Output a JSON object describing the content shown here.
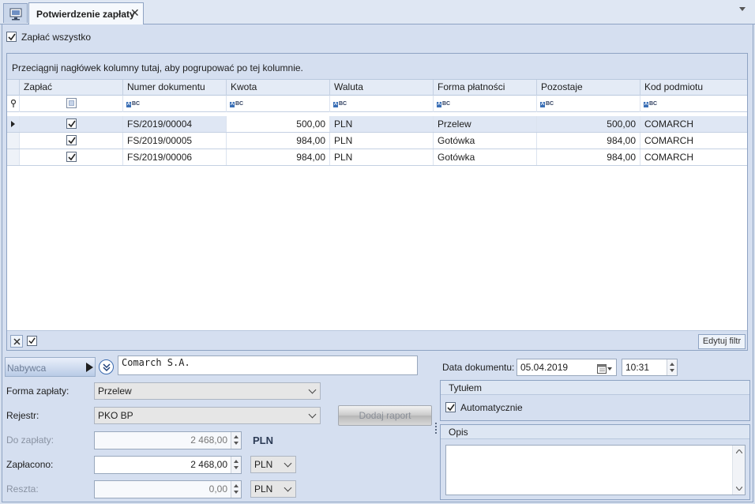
{
  "tab": {
    "title": "Potwierdzenie zapłaty",
    "close_glyph": "✕",
    "icon": "monitor-icon"
  },
  "pay_all": {
    "label": "Zapłać wszystko",
    "checked": true
  },
  "grid": {
    "group_hint": "Przeciągnij nagłówek kolumny tutaj, aby pogrupować po tej kolumnie.",
    "columns": [
      "Zapłać",
      "Numer dokumentu",
      "Kwota",
      "Waluta",
      "Forma płatności",
      "Pozostaje",
      "Kod podmiotu"
    ],
    "rows": [
      {
        "pay": true,
        "doc": "FS/2019/00004",
        "amount": "500,00",
        "currency": "PLN",
        "method": "Przelew",
        "remaining": "500,00",
        "code": "COMARCH",
        "current": true
      },
      {
        "pay": true,
        "doc": "FS/2019/00005",
        "amount": "984,00",
        "currency": "PLN",
        "method": "Gotówka",
        "remaining": "984,00",
        "code": "COMARCH",
        "current": false
      },
      {
        "pay": true,
        "doc": "FS/2019/00006",
        "amount": "984,00",
        "currency": "PLN",
        "method": "Gotówka",
        "remaining": "984,00",
        "code": "COMARCH",
        "current": false
      }
    ],
    "edit_filter": "Edytuj filtr"
  },
  "buyer": {
    "button": "Nabywca",
    "value": "Comarch S.A."
  },
  "payment_form": {
    "label": "Forma zapłaty:",
    "value": "Przelew"
  },
  "register": {
    "label": "Rejestr:",
    "value": "PKO BP"
  },
  "add_report": "Dodaj raport",
  "to_pay": {
    "label": "Do zapłaty:",
    "value": "2 468,00",
    "currency": "PLN"
  },
  "paid": {
    "label": "Zapłacono:",
    "value": "2 468,00",
    "currency": "PLN"
  },
  "change": {
    "label": "Reszta:",
    "value": "0,00",
    "currency": "PLN"
  },
  "doc_date": {
    "label": "Data dokumentu:",
    "date": "05.04.2019",
    "time": "10:31"
  },
  "title_group": {
    "header": "Tytułem",
    "auto_label": "Automatycznie",
    "auto_checked": true
  },
  "desc_group": {
    "header": "Opis",
    "value": ""
  }
}
